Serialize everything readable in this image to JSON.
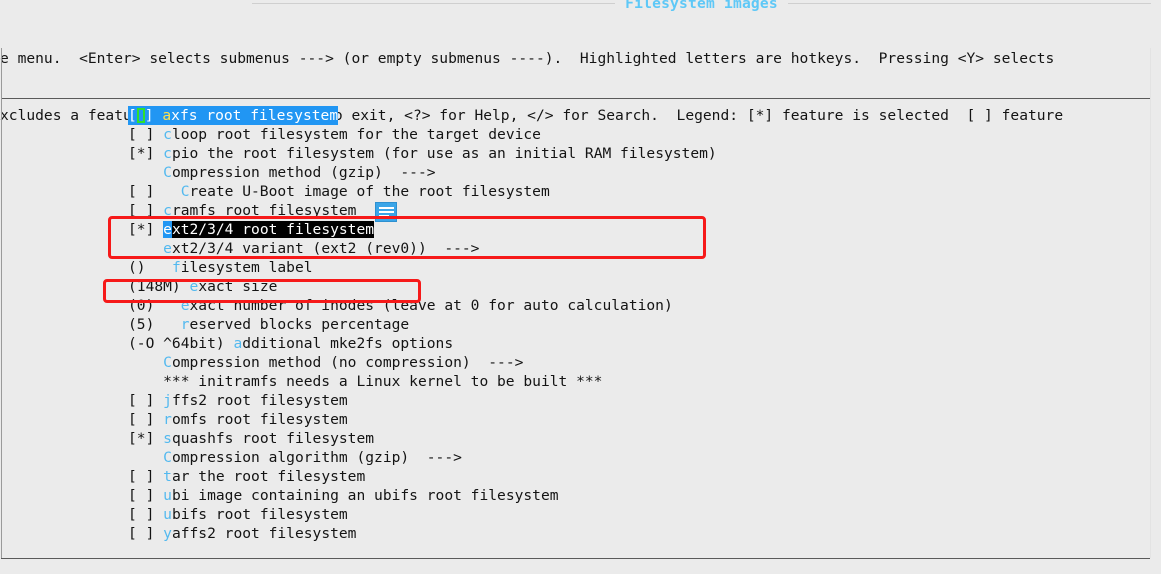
{
  "window": {
    "title": "Filesystem images"
  },
  "help": {
    "line1": "e menu.  <Enter> selects submenus ---> (or empty submenus ----).  Highlighted letters are hotkeys.  Pressing <Y> selects",
    "line2": "xcludes a feature.  Press <Esc><Esc> to exit, <?> for Help, </> for Search.  Legend: [*] feature is selected  [ ] feature"
  },
  "menu": {
    "items": [
      {
        "mark": "[ ]",
        "hotkey": "a",
        "text": "xfs root filesystem",
        "state": "selected-cursor",
        "indent": 0
      },
      {
        "mark": "[ ]",
        "hotkey": "c",
        "text": "loop root filesystem for the target device",
        "state": "normal",
        "indent": 0
      },
      {
        "mark": "[*]",
        "hotkey": "c",
        "text": "pio the root filesystem (for use as an initial RAM filesystem)",
        "state": "normal",
        "indent": 0
      },
      {
        "mark": "",
        "hotkey": "C",
        "text": "ompression method (gzip)  --->",
        "state": "normal",
        "indent": 1
      },
      {
        "mark": "[ ]",
        "hotkey": "C",
        "text": "reate U-Boot image of the root filesystem",
        "state": "normal",
        "indent": 1
      },
      {
        "mark": "[ ]",
        "hotkey": "c",
        "text": "ramfs root filesystem",
        "state": "normal",
        "indent": 0
      },
      {
        "mark": "[*]",
        "hotkey": "e",
        "text": "xt2/3/4 root filesystem",
        "state": "inverse",
        "indent": 0
      },
      {
        "mark": "",
        "hotkey": "e",
        "text": "xt2/3/4 variant (ext2 (rev0))  --->",
        "state": "normal",
        "indent": 1
      },
      {
        "mark": "()",
        "hotkey": "f",
        "text": "ilesystem label",
        "state": "normal",
        "indent": 1
      },
      {
        "mark": "(148M)",
        "hotkey": "e",
        "text": "xact size",
        "state": "normal",
        "indent": 0
      },
      {
        "mark": "(0)",
        "hotkey": "e",
        "text": "xact number of inodes (leave at 0 for auto calculation)",
        "state": "normal",
        "indent": 1
      },
      {
        "mark": "(5)",
        "hotkey": "r",
        "text": "eserved blocks percentage",
        "state": "normal",
        "indent": 1
      },
      {
        "mark": "(-O ^64bit)",
        "hotkey": "a",
        "text": "dditional mke2fs options",
        "state": "normal",
        "indent": 0
      },
      {
        "mark": "",
        "hotkey": "C",
        "text": "ompression method (no compression)  --->",
        "state": "normal",
        "indent": 1
      },
      {
        "mark": "",
        "hotkey": "",
        "text": "*** initramfs needs a Linux kernel to be built ***",
        "state": "note",
        "indent": 1
      },
      {
        "mark": "[ ]",
        "hotkey": "j",
        "text": "ffs2 root filesystem",
        "state": "normal",
        "indent": 0
      },
      {
        "mark": "[ ]",
        "hotkey": "r",
        "text": "omfs root filesystem",
        "state": "normal",
        "indent": 0
      },
      {
        "mark": "[*]",
        "hotkey": "s",
        "text": "quashfs root filesystem",
        "state": "normal",
        "indent": 0
      },
      {
        "mark": "",
        "hotkey": "C",
        "text": "ompression algorithm (gzip)  --->",
        "state": "normal",
        "indent": 1
      },
      {
        "mark": "[ ]",
        "hotkey": "t",
        "text": "ar the root filesystem",
        "state": "normal",
        "indent": 0
      },
      {
        "mark": "[ ]",
        "hotkey": "u",
        "text": "bi image containing an ubifs root filesystem",
        "state": "normal",
        "indent": 0
      },
      {
        "mark": "[ ]",
        "hotkey": "u",
        "text": "bifs root filesystem",
        "state": "normal",
        "indent": 0
      },
      {
        "mark": "[ ]",
        "hotkey": "y",
        "text": "affs2 root filesystem",
        "state": "normal",
        "indent": 0
      }
    ]
  },
  "annotations": [
    {
      "id": "ext2",
      "label": "ext2/3/4 root filesystem highlight"
    },
    {
      "id": "size",
      "label": "exact size highlight"
    }
  ],
  "colors": {
    "accent_blue": "#53b9ef",
    "title_blue": "#5ec8f7",
    "cursor_bg": "#2196f3",
    "cursor_hotkey": "#ffe14d",
    "cursor_outline": "#2ee02e",
    "annotation_red": "#f61919",
    "background": "#ebebeb",
    "text": "#141414"
  }
}
